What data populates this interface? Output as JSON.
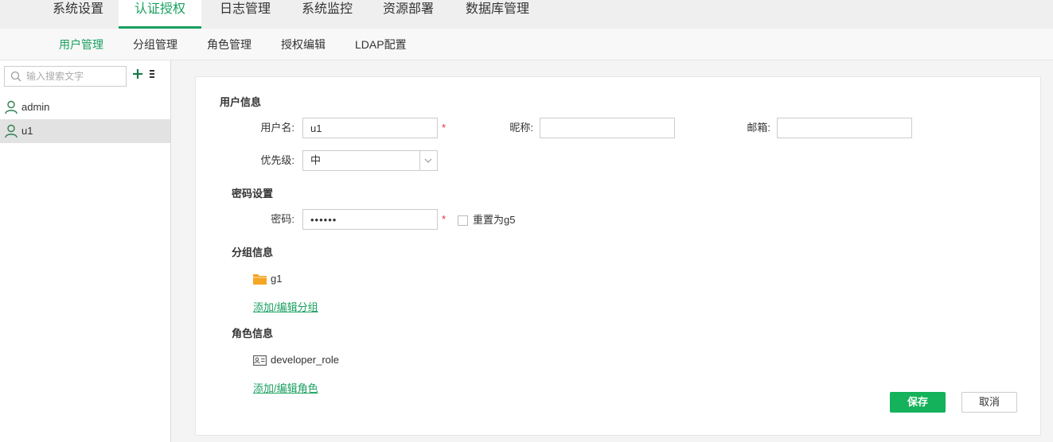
{
  "top_tabs": [
    {
      "label": "系统设置",
      "active": false
    },
    {
      "label": "认证授权",
      "active": true
    },
    {
      "label": "日志管理",
      "active": false
    },
    {
      "label": "系统监控",
      "active": false
    },
    {
      "label": "资源部署",
      "active": false
    },
    {
      "label": "数据库管理",
      "active": false
    }
  ],
  "sub_tabs": [
    {
      "label": "用户管理",
      "active": true
    },
    {
      "label": "分组管理",
      "active": false
    },
    {
      "label": "角色管理",
      "active": false
    },
    {
      "label": "授权编辑",
      "active": false
    },
    {
      "label": "LDAP配置",
      "active": false
    }
  ],
  "sidebar": {
    "search_placeholder": "输入搜索文字",
    "users": [
      {
        "name": "admin",
        "selected": false
      },
      {
        "name": "u1",
        "selected": true
      }
    ]
  },
  "form": {
    "user_info_title": "用户信息",
    "username_label": "用户名:",
    "username_value": "u1",
    "required_mark": "*",
    "nickname_label": "昵称:",
    "nickname_value": "",
    "email_label": "邮箱:",
    "email_value": "",
    "priority_label": "优先级:",
    "priority_value": "中",
    "password_section_title": "密码设置",
    "password_label": "密码:",
    "password_value": "••••••",
    "reset_label": "重置为g5",
    "group_section_title": "分组信息",
    "groups": [
      "g1"
    ],
    "edit_groups_link": "添加/编辑分组",
    "role_section_title": "角色信息",
    "roles": [
      "developer_role"
    ],
    "edit_roles_link": "添加/编辑角色",
    "save_label": "保存",
    "cancel_label": "取消"
  },
  "colors": {
    "accent": "#18a05e",
    "save_button": "#14b25a",
    "folder": "#f5a623",
    "required": "#e03030"
  }
}
